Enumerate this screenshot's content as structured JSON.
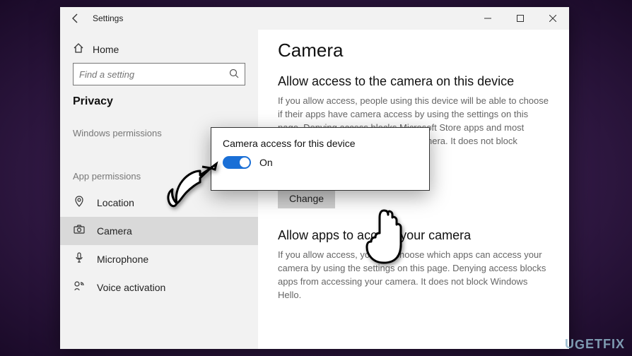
{
  "window": {
    "title": "Settings"
  },
  "sidebar": {
    "home": "Home",
    "searchPlaceholder": "Find a setting",
    "section": "Privacy",
    "group1": "Windows permissions",
    "group2": "App permissions",
    "items": [
      {
        "icon": "📍",
        "label": "Location"
      },
      {
        "icon": "📷",
        "label": "Camera"
      },
      {
        "icon": "🎤",
        "label": "Microphone"
      },
      {
        "icon": "🗣",
        "label": "Voice activation"
      }
    ]
  },
  "content": {
    "pageTitle": "Camera",
    "section1Title": "Allow access to the camera on this device",
    "section1Body": "If you allow access, people using this device will be able to choose if their apps have camera access by using the settings on this page. Denying access blocks Microsoft Store apps and most desktop apps from accessing the camera. It does not block Windows Hello.",
    "statusLine": "Camera access for this device is on",
    "changeLabel": "Change",
    "section2Title": "Allow apps to access your camera",
    "section2Body": "If you allow access, you can choose which apps can access your camera by using the settings on this page. Denying access blocks apps from accessing your camera. It does not block Windows Hello."
  },
  "popup": {
    "title": "Camera access for this device",
    "state": "On"
  },
  "watermark": "UGETFIX"
}
